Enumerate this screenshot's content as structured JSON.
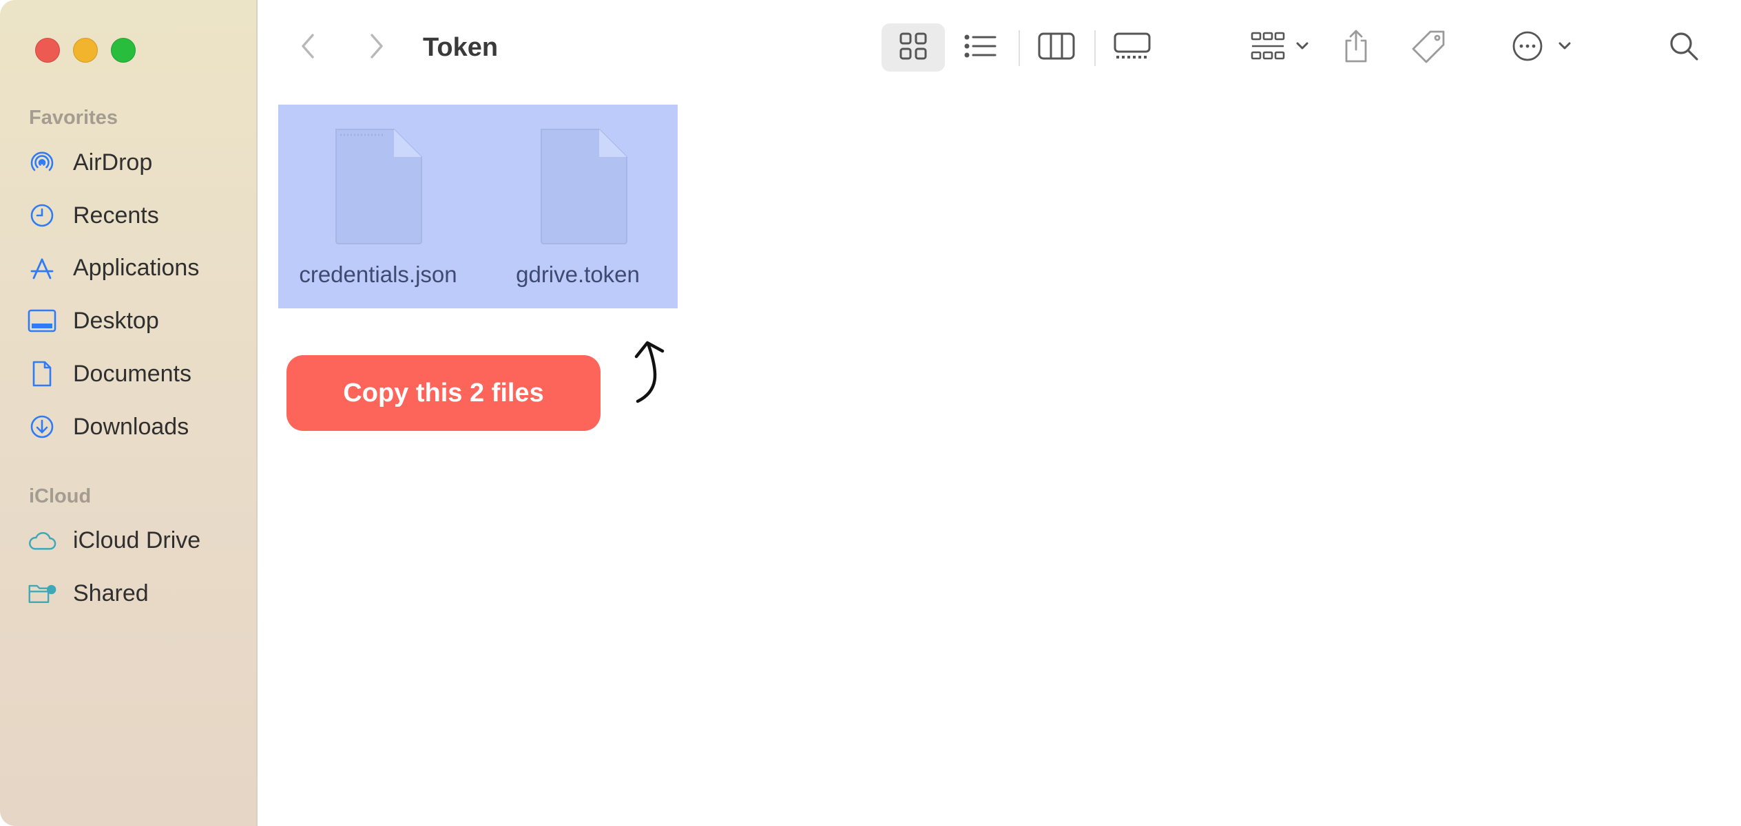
{
  "window": {
    "title": "Token"
  },
  "sidebar": {
    "favorites_title": "Favorites",
    "favorites": [
      {
        "label": "AirDrop",
        "icon": "airdrop-icon"
      },
      {
        "label": "Recents",
        "icon": "clock-icon"
      },
      {
        "label": "Applications",
        "icon": "applications-icon"
      },
      {
        "label": "Desktop",
        "icon": "desktop-icon"
      },
      {
        "label": "Documents",
        "icon": "document-icon"
      },
      {
        "label": "Downloads",
        "icon": "download-icon"
      }
    ],
    "icloud_title": "iCloud",
    "icloud": [
      {
        "label": "iCloud Drive",
        "icon": "cloud-icon"
      },
      {
        "label": "Shared",
        "icon": "shared-folder-icon"
      }
    ]
  },
  "toolbar": {
    "icons": [
      "back-icon",
      "forward-icon",
      "icon-view-icon",
      "list-view-icon",
      "column-view-icon",
      "gallery-view-icon",
      "group-icon",
      "share-icon",
      "tag-icon",
      "more-icon",
      "search-icon"
    ],
    "active_view": "icon-view"
  },
  "files": [
    {
      "name": "credentials.json"
    },
    {
      "name": "gdrive.token"
    }
  ],
  "annotation": {
    "label": "Copy this 2 files"
  },
  "colors": {
    "accent": "#2f7bf5",
    "selection": "#bccbfa",
    "annotation": "#fd645a"
  }
}
